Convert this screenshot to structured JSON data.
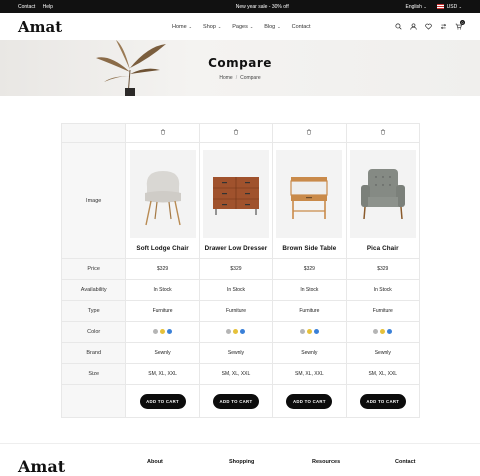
{
  "topbar": {
    "contact": "Contact",
    "help": "Help",
    "announcement": "New year sale - 30% off",
    "language": "English",
    "currency": "USD"
  },
  "header": {
    "logo": "Amat",
    "nav": [
      "Home",
      "Shop",
      "Pages",
      "Blog",
      "Contact"
    ],
    "cart_count": "0"
  },
  "hero": {
    "title": "Compare",
    "breadcrumb_home": "Home",
    "breadcrumb_current": "Compare"
  },
  "labels": {
    "image": "Image",
    "price": "Price",
    "availability": "Availability",
    "type": "Type",
    "color": "Color",
    "brand": "Brand",
    "size": "Size"
  },
  "products": [
    {
      "name": "Soft Lodge Chair",
      "price": "$329",
      "availability": "In Stock",
      "type": "Furniture",
      "brand": "Sewnly",
      "size": "SM, XL, XXL",
      "colors": [
        "#b5b5b5",
        "#e6c13a",
        "#3a80d8"
      ],
      "cart": "ADD TO CART",
      "icon": "lounge-chair-image"
    },
    {
      "name": "Drawer Low Dresser",
      "price": "$329",
      "availability": "In Stock",
      "type": "Furniture",
      "brand": "Sewnly",
      "size": "SM, XL, XXL",
      "colors": [
        "#b5b5b5",
        "#e6c13a",
        "#3a80d8"
      ],
      "cart": "ADD TO CART",
      "icon": "dresser-image"
    },
    {
      "name": "Brown Side Table",
      "price": "$329",
      "availability": "In Stock",
      "type": "Furniture",
      "brand": "Sewnly",
      "size": "SM, XL, XXL",
      "colors": [
        "#b5b5b5",
        "#e6c13a",
        "#3a80d8"
      ],
      "cart": "ADD TO CART",
      "icon": "side-table-image"
    },
    {
      "name": "Pica Chair",
      "price": "$329",
      "availability": "In Stock",
      "type": "Furniture",
      "brand": "Sewnly",
      "size": "SM, XL, XXL",
      "colors": [
        "#b5b5b5",
        "#e6c13a",
        "#3a80d8"
      ],
      "cart": "ADD TO CART",
      "icon": "armchair-image"
    }
  ],
  "footer": {
    "logo": "Amat",
    "headings": [
      "About",
      "Shopping",
      "Resources",
      "Contact"
    ]
  }
}
